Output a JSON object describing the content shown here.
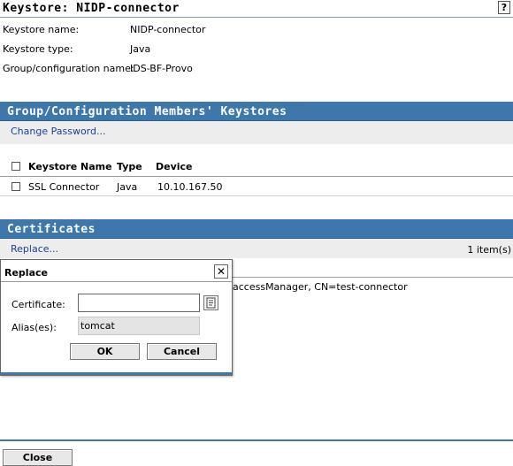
{
  "header": {
    "title": "Keystore: NIDP-connector",
    "help_label": "?"
  },
  "info": [
    {
      "label": "Keystore name:",
      "value": "NIDP-connector"
    },
    {
      "label": "Keystore type:",
      "value": "Java"
    },
    {
      "label": "Group/configuration name:",
      "value": "IDS-BF-Provo"
    }
  ],
  "members": {
    "title": "Group/Configuration Members' Keystores",
    "change_password_link": "Change Password...",
    "columns": [
      "Keystore Name",
      "Type",
      "Device"
    ],
    "rows": [
      {
        "name": "SSL Connector",
        "type": "Java",
        "device": "10.10.167.50"
      }
    ]
  },
  "certificates": {
    "title": "Certificates",
    "replace_link": "Replace...",
    "count": "1 item(s)",
    "row_text_partial": "accessManager, CN=test-connector"
  },
  "dialog": {
    "title": "Replace",
    "close_glyph": "✕",
    "certificate_label": "Certificate:",
    "certificate_value": "",
    "alias_label": "Alias(es):",
    "alias_value": "tomcat",
    "ok_label": "OK",
    "cancel_label": "Cancel"
  },
  "footer": {
    "close_label": "Close"
  },
  "colors": {
    "section_bar": "#3d77ac",
    "link": "#1b3f95",
    "action_strip": "#ededed"
  }
}
